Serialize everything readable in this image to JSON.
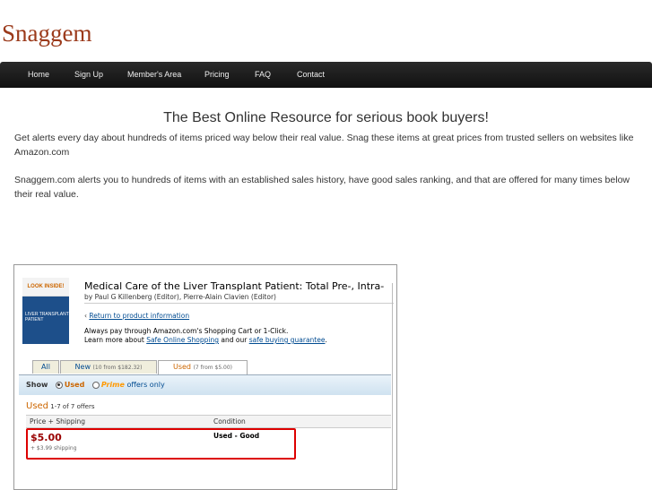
{
  "site": {
    "logo": "Snaggem"
  },
  "nav": {
    "items": [
      {
        "label": "Home"
      },
      {
        "label": "Sign Up"
      },
      {
        "label": "Member's Area"
      },
      {
        "label": "Pricing"
      },
      {
        "label": "FAQ"
      },
      {
        "label": "Contact"
      }
    ]
  },
  "main": {
    "headline": "The Best Online Resource for serious book buyers!",
    "paragraph1": "Get alerts every day about hundreds of items priced way below their real value. Snag these items at great prices from trusted sellers on websites like Amazon.com",
    "paragraph2": "Snaggem.com alerts you to hundreds of items with an established sales history, have good sales ranking, and that are offered for many times below their real value."
  },
  "screenshot": {
    "cover_banner": "LOOK INSIDE!",
    "cover_text": "LIVER TRANSPLANT PATIENT",
    "title": "Medical Care of the Liver Transplant Patient: Total Pre-, Intra-",
    "authors": "by Paul G Killenberg (Editor), Pierre-Alain Clavien (Editor)",
    "return_prefix": "‹ ",
    "return_link": "Return to product information",
    "info_line1": "Always pay through Amazon.com's Shopping Cart or 1-Click.",
    "info_line2_prefix": "Learn more about ",
    "info_link1": "Safe Online Shopping",
    "info_line2_mid": " and our ",
    "info_link2": "safe buying guarantee",
    "info_line2_suffix": ".",
    "tabs": [
      {
        "label": "All",
        "sub": ""
      },
      {
        "label": "New",
        "sub": "(10 from $182.32)"
      },
      {
        "label": "Used",
        "sub": "(7 from $5.00)"
      }
    ],
    "show_label": "Show",
    "option_used": "Used",
    "option_prime": "Prime",
    "option_prime_suffix": " offers only",
    "used_heading": "Used",
    "used_count": " 1-7 of 7 offers",
    "col_price": "Price + Shipping",
    "col_condition": "Condition",
    "offer_price": "$5.00",
    "offer_shipping": "+ $3.99 shipping",
    "offer_condition": "Used - Good",
    "highlight_color": "#dd0000"
  }
}
